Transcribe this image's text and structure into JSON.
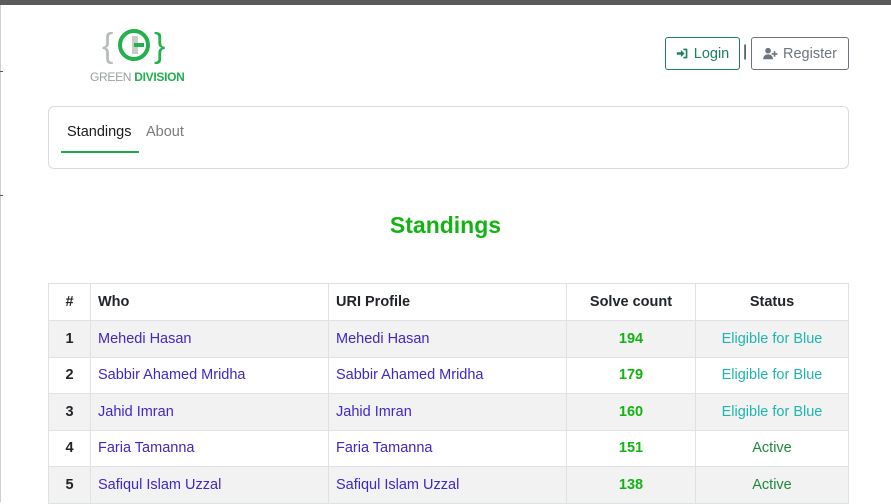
{
  "brand": {
    "logo_text_part1": "GREEN",
    "logo_text_part2": "DIVISION",
    "logo_glyph": "{G}"
  },
  "auth": {
    "login_label": "Login",
    "separator": "|",
    "register_label": "Register"
  },
  "nav": {
    "tabs": [
      {
        "label": "Standings",
        "active": true
      },
      {
        "label": "About",
        "active": false
      }
    ]
  },
  "page": {
    "title": "Standings"
  },
  "table": {
    "headers": [
      "#",
      "Who",
      "URI Profile",
      "Solve count",
      "Status"
    ],
    "rows": [
      {
        "rank": "1",
        "who": "Mehedi Hasan",
        "uri": "Mehedi Hasan",
        "solve": "194",
        "status": "Eligible for Blue"
      },
      {
        "rank": "2",
        "who": "Sabbir Ahamed Mridha",
        "uri": "Sabbir Ahamed Mridha",
        "solve": "179",
        "status": "Eligible for Blue"
      },
      {
        "rank": "3",
        "who": "Jahid Imran",
        "uri": "Jahid Imran",
        "solve": "160",
        "status": "Eligible for Blue"
      },
      {
        "rank": "4",
        "who": "Faria Tamanna",
        "uri": "Faria Tamanna",
        "solve": "151",
        "status": "Active"
      },
      {
        "rank": "5",
        "who": "Safiqul Islam Uzzal",
        "uri": "Safiqul Islam Uzzal",
        "solve": "138",
        "status": "Active"
      }
    ]
  },
  "colors": {
    "accent_green": "#12b312",
    "link_purple": "#3d28c8",
    "status_blue": "#1fb6b0",
    "status_active": "#1e8a3c",
    "login_border": "#1e7e5e"
  }
}
